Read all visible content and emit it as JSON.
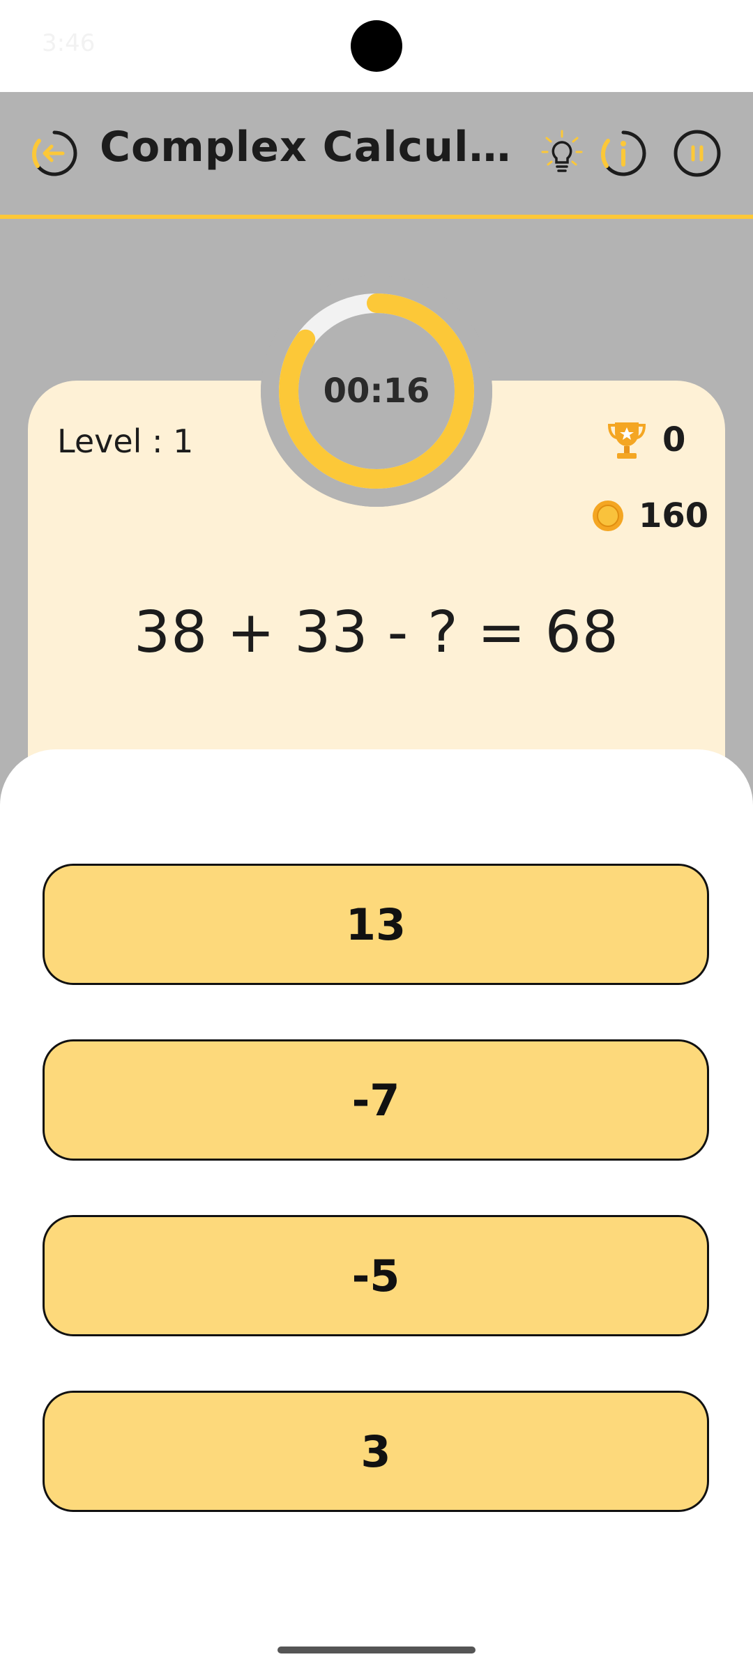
{
  "status_bar": {
    "time": "3:46"
  },
  "header": {
    "title": "Complex Calculati…",
    "back_icon": "back-arrow-circle-icon",
    "hint_icon": "lightbulb-icon",
    "info_icon": "info-circle-icon",
    "pause_icon": "pause-circle-icon"
  },
  "timer": {
    "display": "00:16",
    "progress": 0.85
  },
  "game": {
    "level_label": "Level : 1",
    "trophy_icon": "trophy-icon",
    "score": "0",
    "coin_icon": "coin-icon",
    "coins": "160",
    "equation": "38 + 33 - ? = 68"
  },
  "answers": [
    "13",
    "-7",
    "-5",
    "3"
  ],
  "colors": {
    "accent": "#fcc838",
    "card_bg": "#fef1d6",
    "answer_bg": "#fdd97b",
    "header_bg": "#b3b3b3"
  }
}
